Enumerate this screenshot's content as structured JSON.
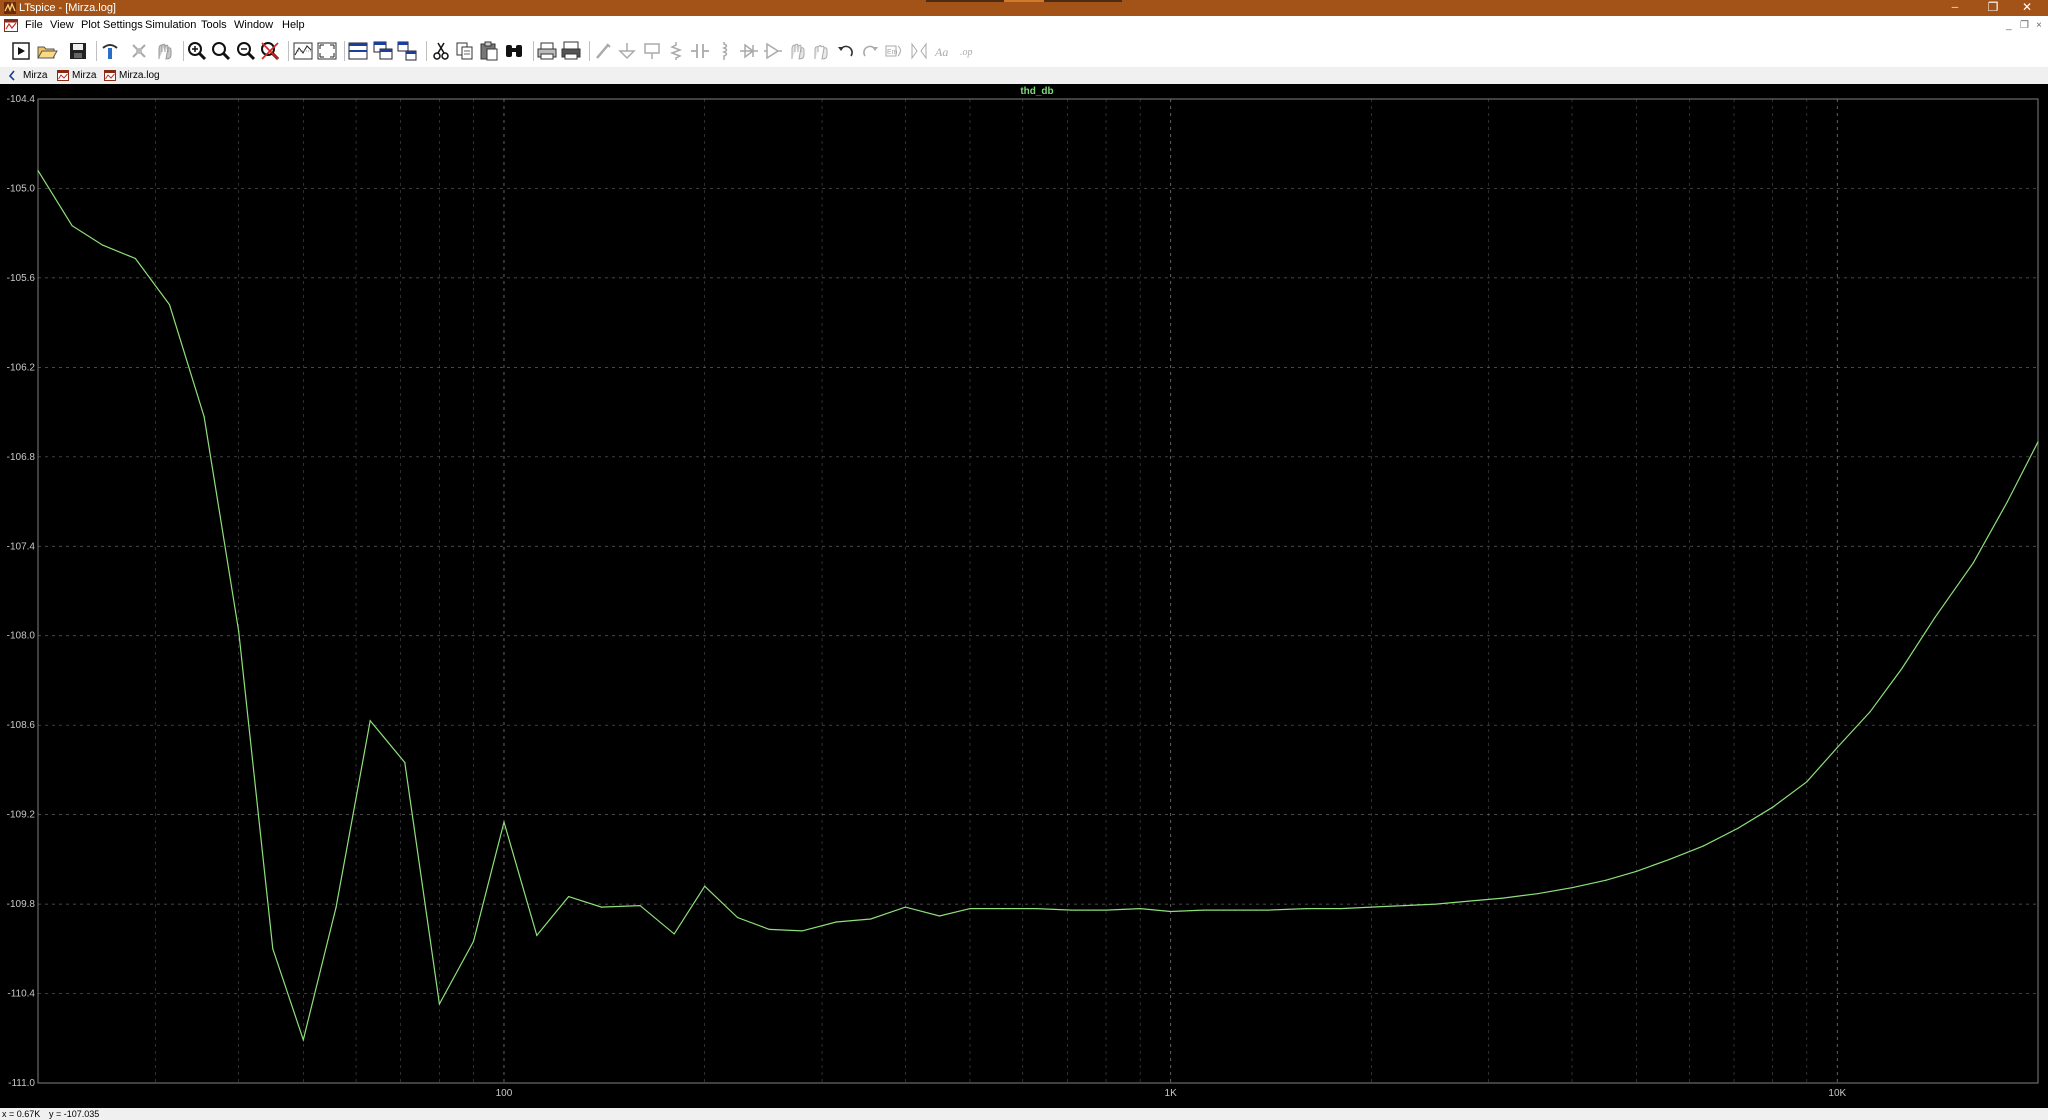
{
  "window": {
    "title": "LTspice - [Mirza.log]",
    "minimize_glyph": "─",
    "restore_glyph": "❐",
    "close_glyph": "✕",
    "accent_color": "#a35317"
  },
  "menu": {
    "items": [
      "File",
      "View",
      "Plot Settings",
      "Simulation",
      "Tools",
      "Window",
      "Help"
    ],
    "mdi_minimize": "_",
    "mdi_restore": "❐",
    "mdi_close": "×"
  },
  "toolbar": {
    "buttons": [
      "run-icon",
      "open-icon",
      "save-icon",
      "control-panel-icon",
      "pause-icon",
      "halt-icon",
      "zoom-in-icon",
      "zoom-area-icon",
      "zoom-out-icon",
      "zoom-cancel-icon",
      "autorange-icon",
      "zoom-extents-icon",
      "tile-horizontal-icon",
      "cascade-icon",
      "tile-vertical-icon",
      "cut-icon",
      "copy-icon",
      "paste-icon",
      "find-icon",
      "print-icon",
      "print-preview-icon",
      "wire-icon",
      "ground-icon",
      "label-net-icon",
      "resistor-icon",
      "capacitor-icon",
      "inductor-icon",
      "diode-icon",
      "component-icon",
      "move-icon",
      "drag-icon",
      "undo-icon",
      "redo-icon",
      "rotate-icon",
      "mirror-icon",
      "text-icon",
      "spice-directive-icon"
    ]
  },
  "tabs": [
    {
      "label": "Mirza",
      "icon": "schematic-icon"
    },
    {
      "label": "Mirza",
      "icon": "waveform-icon"
    },
    {
      "label": "Mirza.log",
      "icon": "log-icon"
    }
  ],
  "plot": {
    "background": "#000000",
    "grid_color": "#808080",
    "trace_color": "#8ee07a",
    "axis_label_color": "#c8c8c8",
    "trace_label_color": "#7fd97a"
  },
  "chart_data": {
    "type": "line",
    "title": "",
    "xlabel": "",
    "ylabel": "",
    "x_scale": "log",
    "xlim": [
      20,
      20000
    ],
    "ylim": [
      -111.0,
      -104.4
    ],
    "x_ticks": [
      100,
      1000,
      10000
    ],
    "x_tick_labels": [
      "100",
      "1K",
      "10K"
    ],
    "y_ticks": [
      -104.4,
      -105.0,
      -105.6,
      -106.2,
      -106.8,
      -107.4,
      -108.0,
      -108.6,
      -109.2,
      -109.8,
      -110.4,
      -111.0
    ],
    "y_tick_labels": [
      "-104.4",
      "-105.0",
      "-105.6",
      "-106.2",
      "-106.8",
      "-107.4",
      "-108.0",
      "-108.6",
      "-109.2",
      "-109.8",
      "-110.4",
      "-111.0"
    ],
    "grid": true,
    "series": [
      {
        "name": "thd_db",
        "x": [
          20,
          22.5,
          25,
          28,
          31.5,
          35.5,
          40,
          45,
          50,
          56,
          63,
          71,
          80,
          90,
          100,
          112,
          125,
          140,
          160,
          180,
          200,
          224,
          250,
          280,
          315,
          355,
          400,
          450,
          500,
          560,
          630,
          710,
          800,
          900,
          1000,
          1120,
          1250,
          1400,
          1600,
          1800,
          2000,
          2240,
          2500,
          2800,
          3150,
          3550,
          4000,
          4500,
          5000,
          5600,
          6300,
          7100,
          8000,
          9000,
          10000,
          11200,
          12500,
          14000,
          16000,
          18000,
          20000
        ],
        "y": [
          -104.88,
          -105.25,
          -105.38,
          -105.47,
          -105.78,
          -106.53,
          -107.97,
          -110.1,
          -110.71,
          -109.82,
          -108.57,
          -108.85,
          -110.47,
          -110.05,
          -109.25,
          -110.01,
          -109.75,
          -109.82,
          -109.81,
          -110.0,
          -109.68,
          -109.89,
          -109.97,
          -109.98,
          -109.92,
          -109.9,
          -109.82,
          -109.88,
          -109.83,
          -109.83,
          -109.83,
          -109.84,
          -109.84,
          -109.83,
          -109.85,
          -109.84,
          -109.84,
          -109.84,
          -109.83,
          -109.83,
          -109.82,
          -109.81,
          -109.8,
          -109.78,
          -109.76,
          -109.73,
          -109.69,
          -109.64,
          -109.58,
          -109.5,
          -109.41,
          -109.29,
          -109.15,
          -108.98,
          -108.75,
          -108.51,
          -108.22,
          -107.88,
          -107.51,
          -107.1,
          -106.7
        ]
      }
    ]
  },
  "status": {
    "x_readout": "x = 0.67K",
    "y_readout": "y = -107.035"
  }
}
